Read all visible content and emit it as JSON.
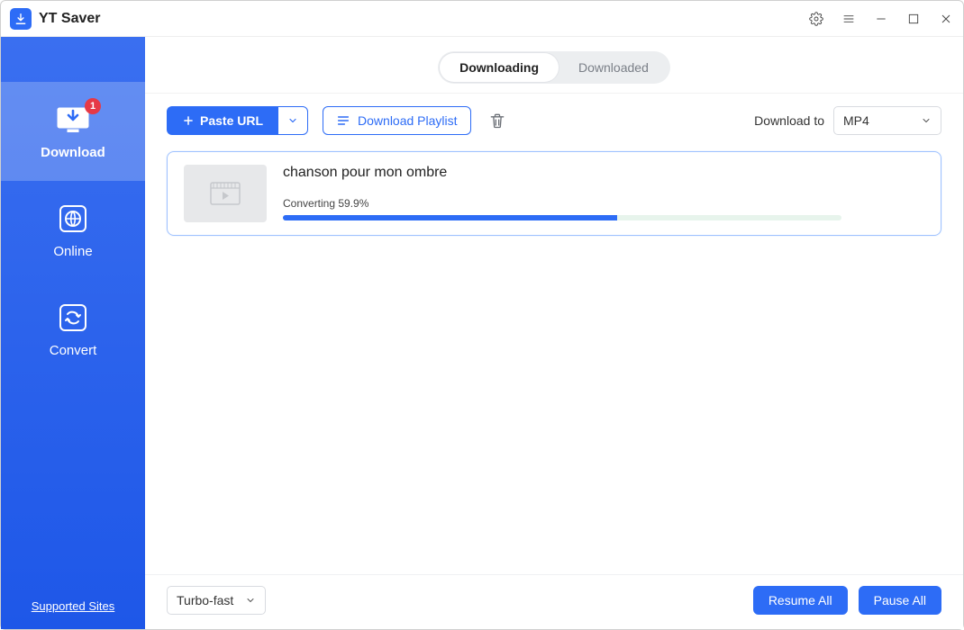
{
  "app": {
    "name": "YT Saver"
  },
  "window": {
    "settings_icon": "gear-icon",
    "menu_icon": "hamburger-icon",
    "min_icon": "minimize-icon",
    "max_icon": "maximize-icon",
    "close_icon": "close-icon"
  },
  "sidebar": {
    "items": [
      {
        "key": "download",
        "label": "Download",
        "badge": "1",
        "active": true
      },
      {
        "key": "online",
        "label": "Online",
        "active": false
      },
      {
        "key": "convert",
        "label": "Convert",
        "active": false
      }
    ],
    "bottom_link": "Supported Sites"
  },
  "tabs": {
    "downloading": "Downloading",
    "downloaded": "Downloaded",
    "active": "downloading"
  },
  "toolbar": {
    "paste_label": "Paste URL",
    "playlist_label": "Download Playlist",
    "download_to_label": "Download to",
    "format_selected": "MP4"
  },
  "items": [
    {
      "title": "chanson pour mon ombre",
      "status_prefix": "Converting",
      "percent_text": "59.9%",
      "percent_value": 59.9
    }
  ],
  "footer": {
    "speed_selected": "Turbo-fast",
    "resume_all": "Resume All",
    "pause_all": "Pause All"
  }
}
